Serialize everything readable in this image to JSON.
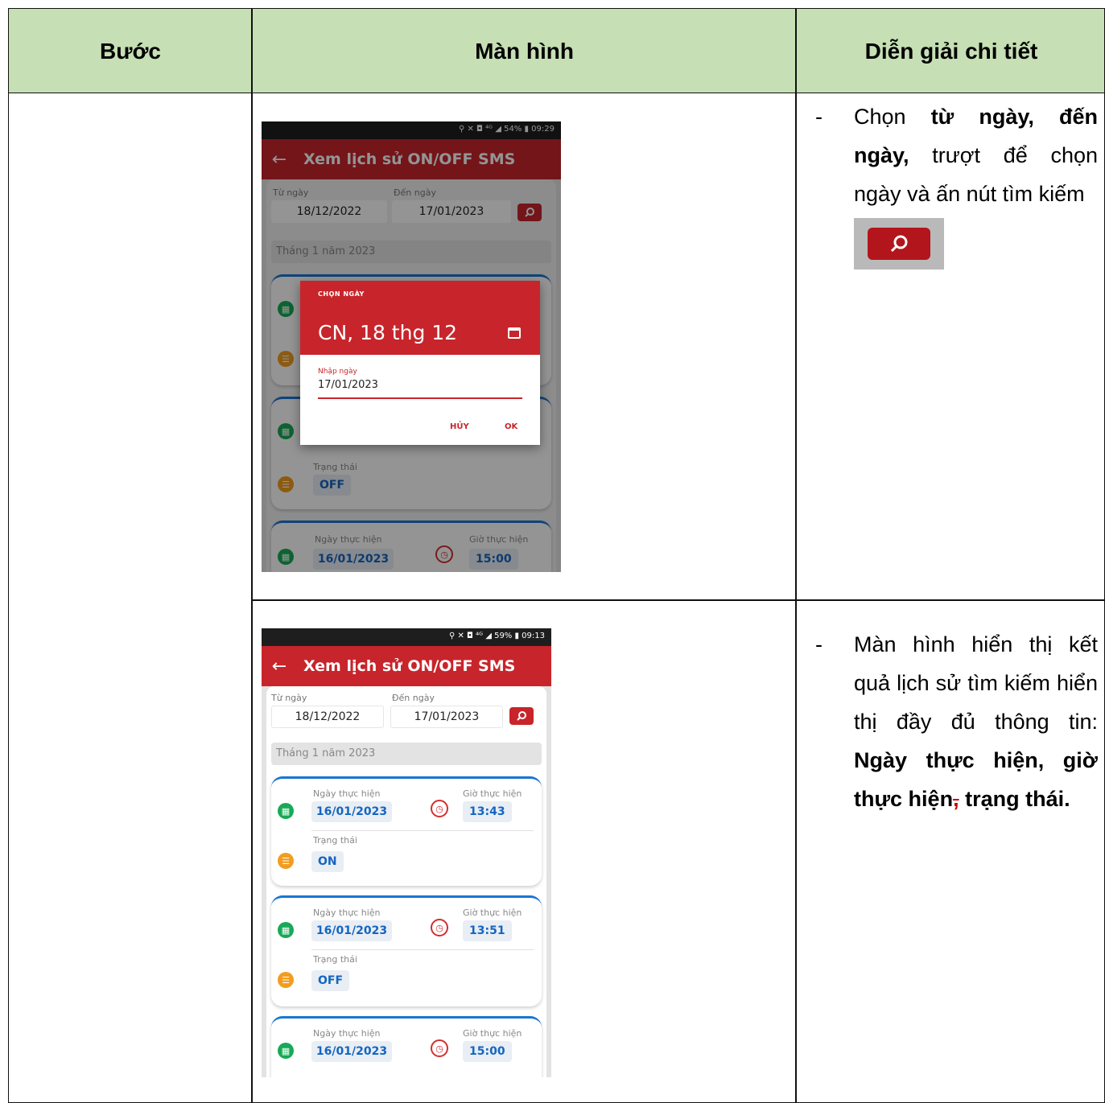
{
  "table": {
    "headers": {
      "step": "Bước",
      "screen": "Màn hình",
      "detail": "Diễn giải chi tiết"
    }
  },
  "rows": [
    {
      "desc": {
        "dash": "-",
        "p1": "Chọn ",
        "b1": "từ ngày, đến ngày,",
        "p2": " trượt để chọn ngày và ấn nút tìm kiếm"
      }
    },
    {
      "desc": {
        "dash": "-",
        "p1": "Màn hình hiển thị kết quả lịch sử tìm kiếm hiển thị đầy đủ thông tin: ",
        "b1": "Ngày thực hiện, giờ thực hiện",
        "strike": ",",
        "b2": " trạng thái."
      }
    }
  ],
  "screen1": {
    "status": "⚲ ✕ ◘ ⁴ᴳ ◢ 54% ▮ 09:29",
    "title": "Xem lịch sử ON/OFF SMS",
    "from_label": "Từ ngày",
    "to_label": "Đến ngày",
    "from_value": "18/12/2022",
    "to_value": "17/01/2023",
    "month": "Tháng 1 năm 2023",
    "dialog": {
      "caption": "CHỌN NGÀY",
      "date": "CN, 18 thg 12",
      "input_label": "Nhập ngày",
      "input_value": "17/01/2023",
      "cancel": "HỦY",
      "ok": "OK"
    },
    "cards": [
      {
        "status_label": "Trạng thái",
        "status": "OFF"
      },
      {
        "date_label": "Ngày thực hiện",
        "time_label": "Giờ thực hiện",
        "date": "16/01/2023",
        "time": "15:00"
      }
    ]
  },
  "screen2": {
    "status": "⚲ ✕ ◘ ⁴ᴳ ◢ 59% ▮ 09:13",
    "title": "Xem lịch sử ON/OFF SMS",
    "from_label": "Từ ngày",
    "to_label": "Đến ngày",
    "from_value": "18/12/2022",
    "to_value": "17/01/2023",
    "month": "Tháng 1 năm 2023",
    "cards": [
      {
        "date_label": "Ngày thực hiện",
        "time_label": "Giờ thực hiện",
        "date": "16/01/2023",
        "time": "13:43",
        "status_label": "Trạng thái",
        "status": "ON"
      },
      {
        "date_label": "Ngày thực hiện",
        "time_label": "Giờ thực hiện",
        "date": "16/01/2023",
        "time": "13:51",
        "status_label": "Trạng thái",
        "status": "OFF"
      },
      {
        "date_label": "Ngày thực hiện",
        "time_label": "Giờ thực hiện",
        "date": "16/01/2023",
        "time": "15:00"
      }
    ]
  },
  "colors": {
    "header_bg": "#c6dfb4",
    "brand_red": "#c7252b",
    "accent_blue": "#1976d2"
  },
  "icons": [
    "back-arrow-icon",
    "search-icon",
    "calendar-icon",
    "clock-icon",
    "list-icon"
  ]
}
